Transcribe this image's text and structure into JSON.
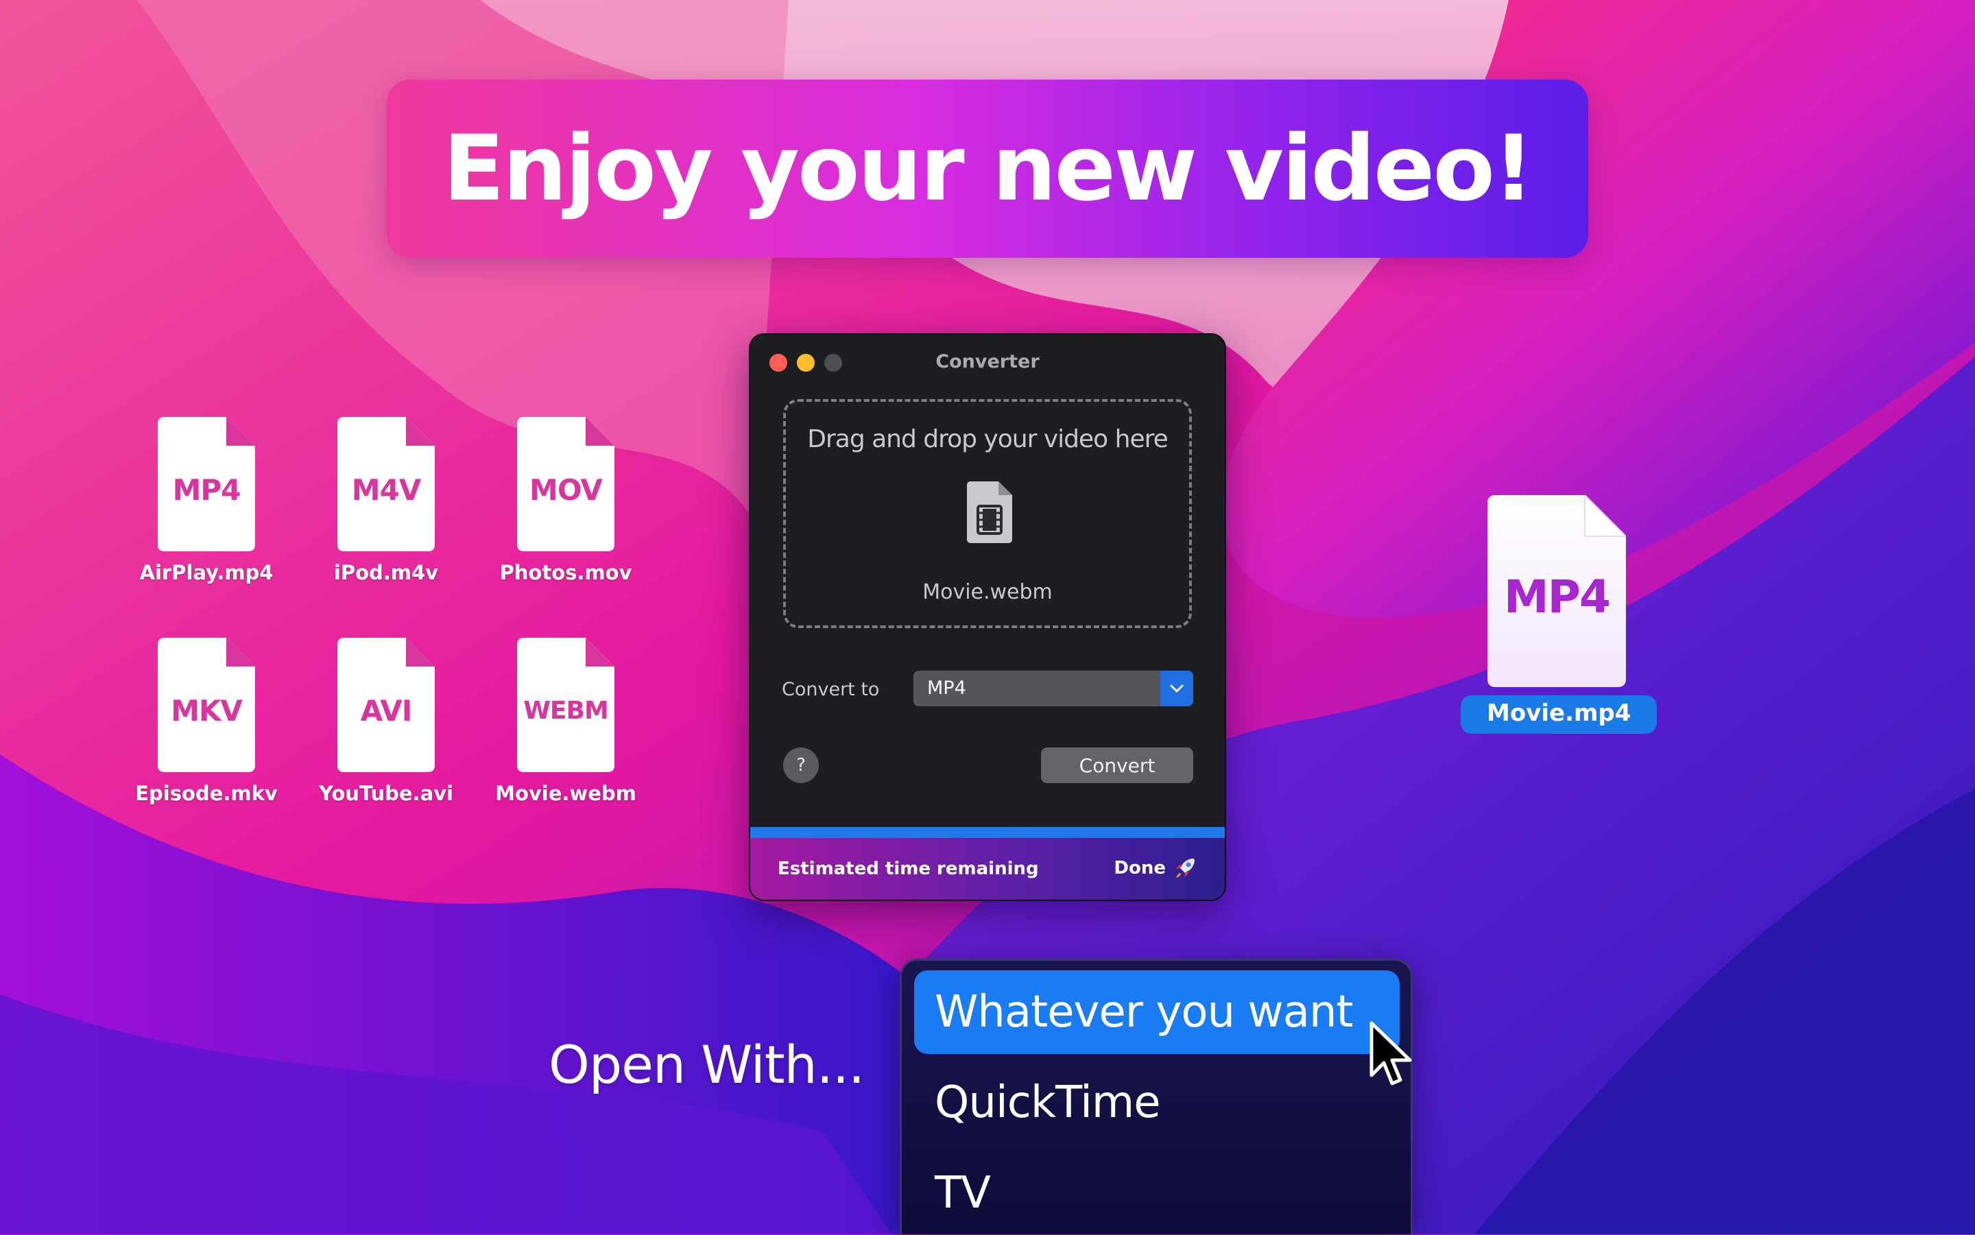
{
  "banner": {
    "title": "Enjoy your new video!"
  },
  "files": [
    {
      "ext": "MP4",
      "label": "AirPlay.mp4"
    },
    {
      "ext": "M4V",
      "label": "iPod.m4v"
    },
    {
      "ext": "MOV",
      "label": "Photos.mov"
    },
    {
      "ext": "MKV",
      "label": "Episode.mkv"
    },
    {
      "ext": "AVI",
      "label": "YouTube.avi"
    },
    {
      "ext": "WEBM",
      "label": "Movie.webm"
    }
  ],
  "window": {
    "title": "Converter",
    "dropzone": {
      "prompt": "Drag and drop your video here",
      "file_name": "Movie.webm",
      "icon": "film-document-icon"
    },
    "convert_to": {
      "label": "Convert to",
      "selected": "MP4"
    },
    "help_label": "?",
    "convert_button": "Convert",
    "progress": 1.0,
    "status": {
      "text": "Estimated time remaining",
      "done": "Done",
      "icon": "rocket-icon"
    }
  },
  "output": {
    "ext": "MP4",
    "label": "Movie.mp4"
  },
  "open_with": {
    "label": "Open With...",
    "items": [
      "Whatever you want",
      "QuickTime",
      "TV"
    ],
    "selected_index": 0
  },
  "colors": {
    "accent": "#1a7cf4",
    "file_text": "#d8359d",
    "output_text": "#a826d0"
  }
}
